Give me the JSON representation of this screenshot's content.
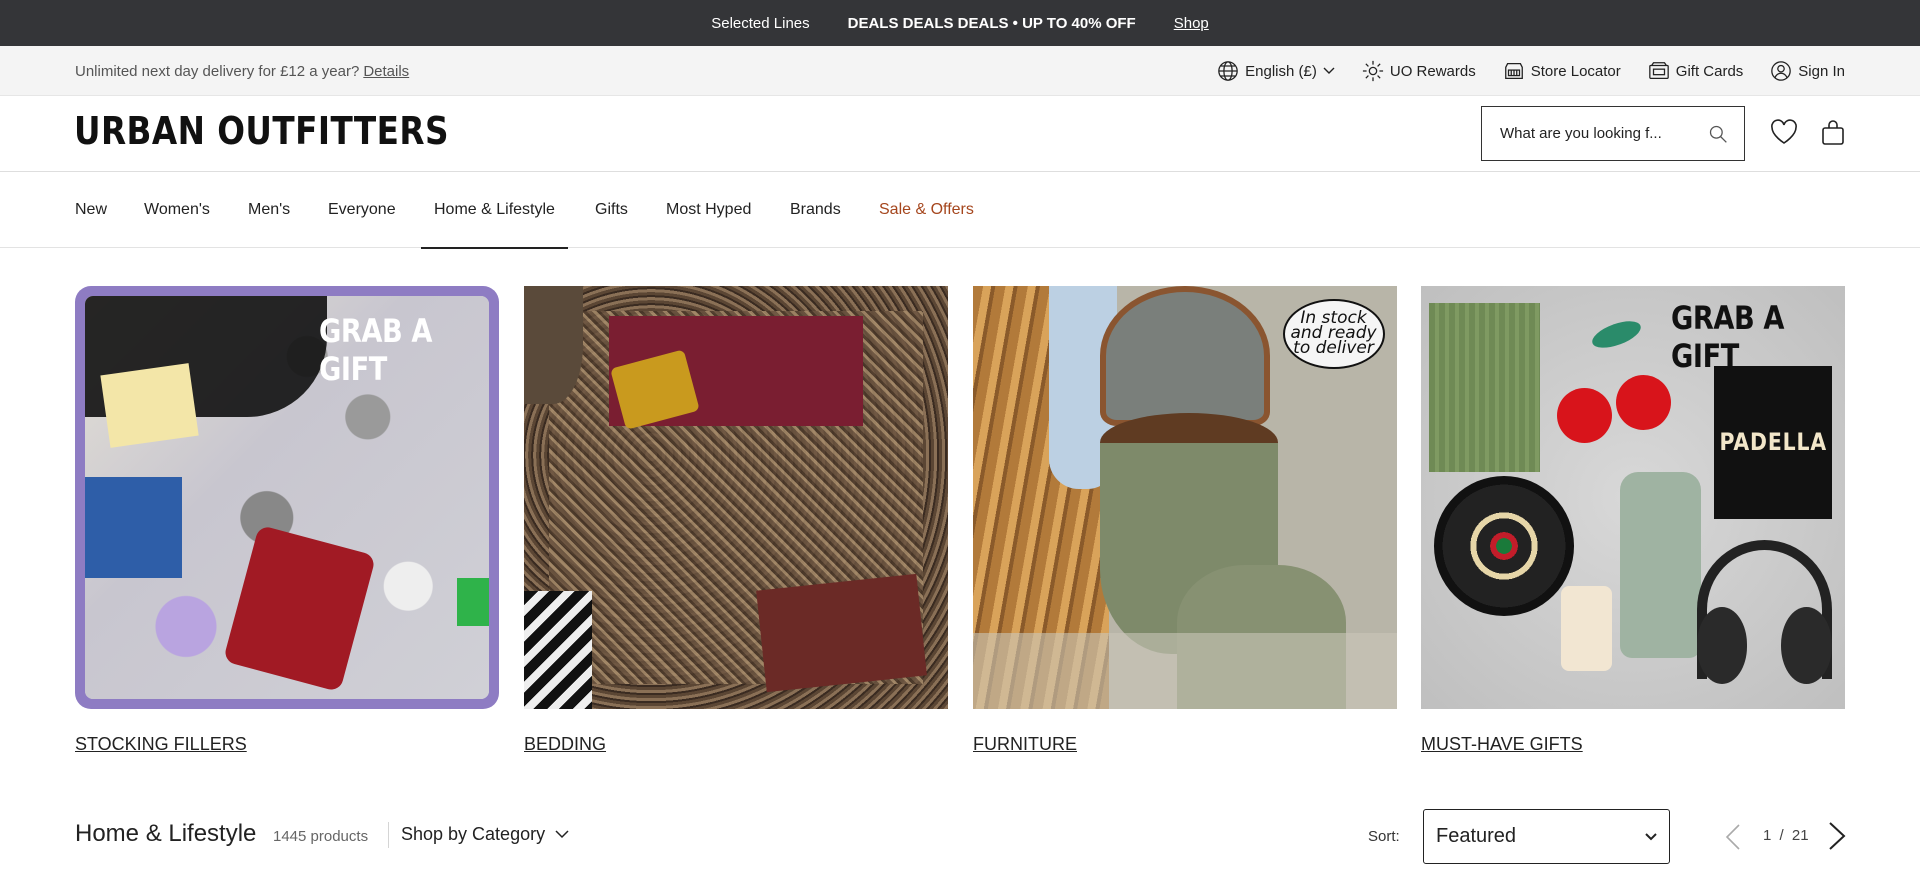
{
  "promo": {
    "item1": "Selected Lines",
    "item2": "DEALS DEALS DEALS • UP TO 40% OFF",
    "link": "Shop"
  },
  "utility": {
    "delivery_text": "Unlimited next day delivery for £12 a year?",
    "details_link": "Details",
    "language": "English (£)",
    "rewards": "UO Rewards",
    "store_locator": "Store Locator",
    "gift_cards": "Gift Cards",
    "sign_in": "Sign In"
  },
  "header": {
    "logo": "URBAN OUTFITTERS",
    "search_placeholder": "What are you looking f..."
  },
  "nav": {
    "items": [
      {
        "label": "New"
      },
      {
        "label": "Women's"
      },
      {
        "label": "Men's"
      },
      {
        "label": "Everyone"
      },
      {
        "label": "Home & Lifestyle"
      },
      {
        "label": "Gifts"
      },
      {
        "label": "Most Hyped"
      },
      {
        "label": "Brands"
      },
      {
        "label": "Sale & Offers"
      }
    ],
    "active": "Home & Lifestyle"
  },
  "tiles": [
    {
      "caption": "STOCKING FILLERS",
      "overlay": "GRAB A GIFT"
    },
    {
      "caption": "BEDDING"
    },
    {
      "caption": "FURNITURE",
      "badge": "In stock and ready to deliver"
    },
    {
      "caption": "MUST-HAVE GIFTS",
      "overlay": "GRAB A GIFT",
      "book_title": "PADELLA"
    }
  ],
  "listing": {
    "title": "Home & Lifestyle",
    "count": "1445 products",
    "shop_by": "Shop by Category",
    "sort_label": "Sort:",
    "sort_value": "Featured",
    "page_current": "1",
    "page_sep": "/",
    "page_total": "21"
  },
  "colors": {
    "promo_bg": "#343538",
    "utility_bg": "#f4f4f4",
    "sale": "#a5461d",
    "tile1_frame": "#8e7cc3"
  }
}
